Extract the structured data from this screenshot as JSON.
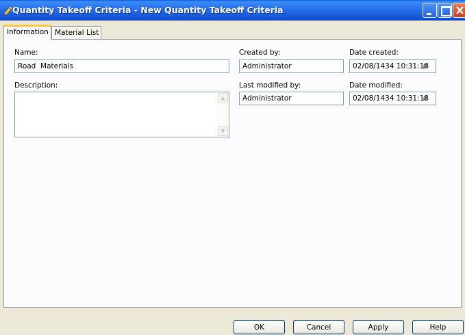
{
  "window": {
    "title": "Quantity Takeoff Criteria - New Quantity Takeoff Criteria"
  },
  "tabs": [
    {
      "label": "Information",
      "active": true
    },
    {
      "label": "Material List",
      "active": false
    }
  ],
  "info": {
    "name_label": "Name:",
    "name_value": "Road  Materials",
    "description_label": "Description:",
    "description_value": "",
    "created_by_label": "Created by:",
    "created_by_value": "Administrator",
    "date_created_label": "Date created:",
    "date_created_value": "02/08/1434 10:31:18",
    "date_created_suffix": "ρ",
    "last_modified_by_label": "Last modified by:",
    "last_modified_by_value": "Administrator",
    "date_modified_label": "Date modified:",
    "date_modified_value": "02/08/1434 10:31:18",
    "date_modified_suffix": "ρ"
  },
  "buttons": {
    "ok": "OK",
    "cancel": "Cancel",
    "apply": "Apply",
    "help": "Help"
  },
  "colors": {
    "titlebar": "#2A72EE",
    "dialog_bg": "#ECE9D8",
    "panel_bg": "#FCFCFE",
    "active_tab_accent": "#FFC83C"
  }
}
